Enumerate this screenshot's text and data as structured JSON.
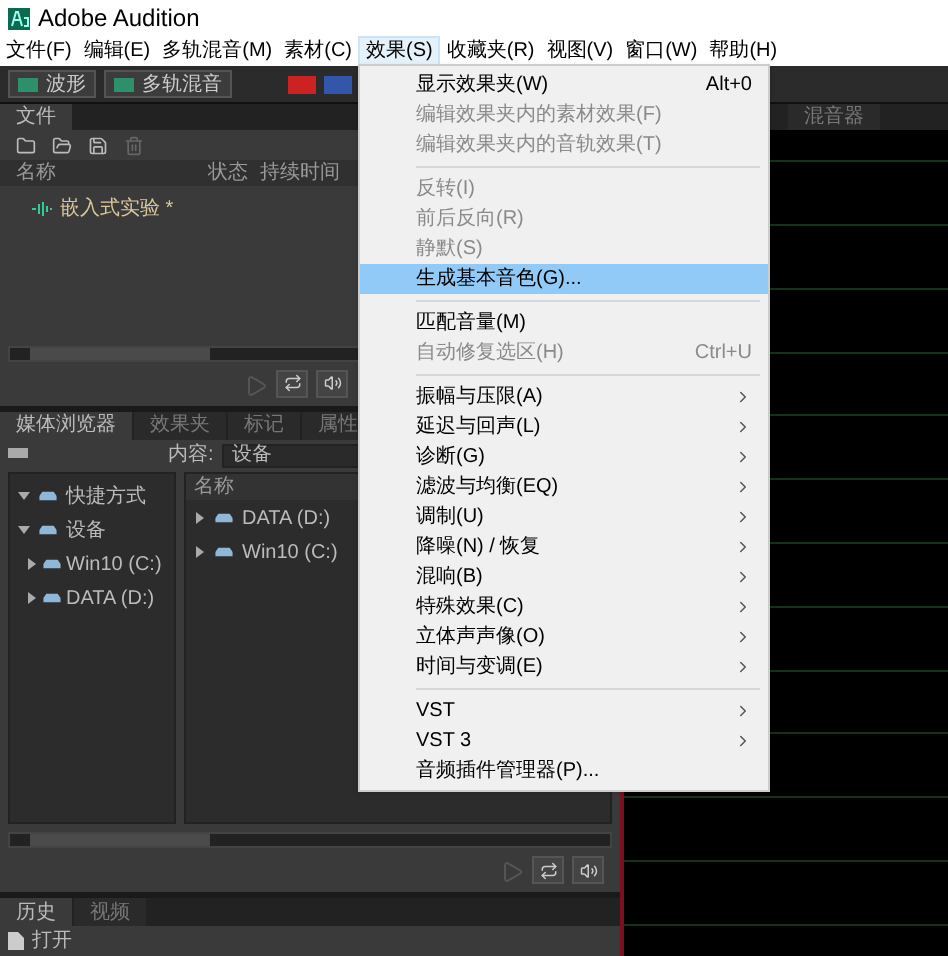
{
  "window": {
    "title": "Adobe Audition"
  },
  "menu_bar": [
    {
      "label": "文件(F)",
      "selected": false
    },
    {
      "label": "编辑(E)",
      "selected": false
    },
    {
      "label": "多轨混音(M)",
      "selected": false
    },
    {
      "label": "素材(C)",
      "selected": false
    },
    {
      "label": "效果(S)",
      "selected": true
    },
    {
      "label": "收藏夹(R)",
      "selected": false
    },
    {
      "label": "视图(V)",
      "selected": false
    },
    {
      "label": "窗口(W)",
      "selected": false
    },
    {
      "label": "帮助(H)",
      "selected": false
    }
  ],
  "toolbar": {
    "buttons": [
      "波形",
      "多轨混音"
    ]
  },
  "files_panel": {
    "tabs": [
      {
        "label": "文件",
        "selected": true
      }
    ],
    "columns": [
      "名称",
      "状态",
      "持续时间"
    ],
    "rows": [
      {
        "name": "嵌入式实验 *"
      }
    ]
  },
  "media_panel": {
    "tabs": [
      {
        "label": "媒体浏览器",
        "selected": true
      },
      {
        "label": "效果夹",
        "selected": false
      },
      {
        "label": "标记",
        "selected": false
      },
      {
        "label": "属性",
        "selected": false
      }
    ],
    "content_label": "内容:",
    "content_value": "设备",
    "tree": [
      {
        "label": "快捷方式",
        "expanded": true
      },
      {
        "label": "设备",
        "expanded": true,
        "children": [
          {
            "label": "Win10 (C:)",
            "expanded": false
          },
          {
            "label": "DATA (D:)",
            "expanded": false
          }
        ]
      }
    ],
    "list_header": "名称",
    "list": [
      {
        "label": "DATA (D:)",
        "expanded": false
      },
      {
        "label": "Win10 (C:)",
        "expanded": false
      }
    ]
  },
  "history_panel": {
    "tabs": [
      {
        "label": "历史",
        "selected": true
      },
      {
        "label": "视频",
        "selected": false
      }
    ],
    "rows": [
      "打开"
    ]
  },
  "mixer_panel": {
    "tab": "混音器"
  },
  "effects_menu": [
    {
      "kind": "item",
      "label": "显示效果夹(W)",
      "shortcut": "Alt+0",
      "disabled": false,
      "selected": false,
      "submenu": false
    },
    {
      "kind": "item",
      "label": "编辑效果夹内的素材效果(F)",
      "disabled": true,
      "selected": false,
      "submenu": false
    },
    {
      "kind": "item",
      "label": "编辑效果夹内的音轨效果(T)",
      "disabled": true,
      "selected": false,
      "submenu": false
    },
    {
      "kind": "separator"
    },
    {
      "kind": "item",
      "label": "反转(I)",
      "disabled": true,
      "selected": false,
      "submenu": false
    },
    {
      "kind": "item",
      "label": "前后反向(R)",
      "disabled": true,
      "selected": false,
      "submenu": false
    },
    {
      "kind": "item",
      "label": "静默(S)",
      "disabled": true,
      "selected": false,
      "submenu": false
    },
    {
      "kind": "item",
      "label": "生成基本音色(G)...",
      "disabled": false,
      "selected": true,
      "submenu": false
    },
    {
      "kind": "separator"
    },
    {
      "kind": "item",
      "label": "匹配音量(M)",
      "disabled": false,
      "selected": false,
      "submenu": false
    },
    {
      "kind": "item",
      "label": "自动修复选区(H)",
      "shortcut": "Ctrl+U",
      "disabled": true,
      "selected": false,
      "submenu": false
    },
    {
      "kind": "separator"
    },
    {
      "kind": "item",
      "label": "振幅与压限(A)",
      "disabled": false,
      "selected": false,
      "submenu": true
    },
    {
      "kind": "item",
      "label": "延迟与回声(L)",
      "disabled": false,
      "selected": false,
      "submenu": true
    },
    {
      "kind": "item",
      "label": "诊断(G)",
      "disabled": false,
      "selected": false,
      "submenu": true
    },
    {
      "kind": "item",
      "label": "滤波与均衡(EQ)",
      "disabled": false,
      "selected": false,
      "submenu": true
    },
    {
      "kind": "item",
      "label": "调制(U)",
      "disabled": false,
      "selected": false,
      "submenu": true
    },
    {
      "kind": "item",
      "label": "降噪(N) / 恢复",
      "disabled": false,
      "selected": false,
      "submenu": true
    },
    {
      "kind": "item",
      "label": "混响(B)",
      "disabled": false,
      "selected": false,
      "submenu": true
    },
    {
      "kind": "item",
      "label": "特殊效果(C)",
      "disabled": false,
      "selected": false,
      "submenu": true
    },
    {
      "kind": "item",
      "label": "立体声声像(O)",
      "disabled": false,
      "selected": false,
      "submenu": true
    },
    {
      "kind": "item",
      "label": "时间与变调(E)",
      "disabled": false,
      "selected": false,
      "submenu": true
    },
    {
      "kind": "separator"
    },
    {
      "kind": "item",
      "label": "VST",
      "disabled": false,
      "selected": false,
      "submenu": true
    },
    {
      "kind": "item",
      "label": "VST 3",
      "disabled": false,
      "selected": false,
      "submenu": true
    },
    {
      "kind": "item",
      "label": "音频插件管理器(P)...",
      "disabled": false,
      "selected": false,
      "submenu": false
    }
  ]
}
